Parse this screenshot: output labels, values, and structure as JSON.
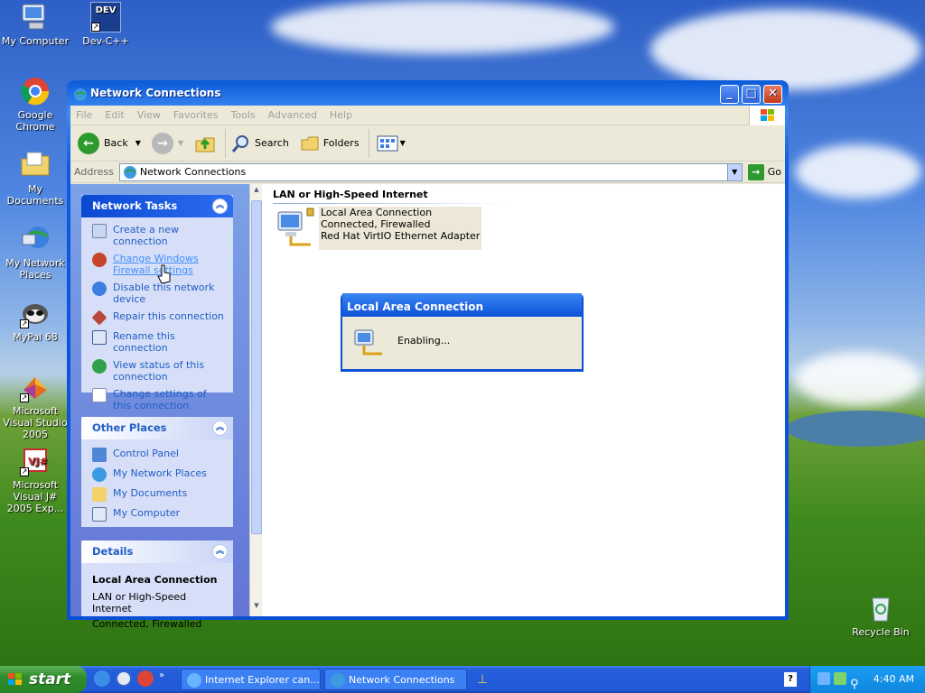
{
  "desktop": {
    "icons": [
      {
        "label": "My Computer"
      },
      {
        "label": "Dev-C++"
      },
      {
        "label": "Google Chrome"
      },
      {
        "label": "My Documents"
      },
      {
        "label": "My Network Places"
      },
      {
        "label": "MyPal 68"
      },
      {
        "label": "Microsoft Visual Studio 2005"
      },
      {
        "label": "Microsoft Visual J# 2005 Exp..."
      },
      {
        "label": "Recycle Bin"
      }
    ],
    "devcpp_badge": "DEV"
  },
  "window": {
    "title": "Network Connections",
    "minimize": "_",
    "maximize": "□",
    "close": "✕",
    "menu": [
      "File",
      "Edit",
      "View",
      "Favorites",
      "Tools",
      "Advanced",
      "Help"
    ],
    "toolbar": {
      "back": "Back",
      "search": "Search",
      "folders": "Folders"
    },
    "address": {
      "label": "Address",
      "value": "Network Connections",
      "go": "Go"
    }
  },
  "left_panel": {
    "network_tasks": {
      "title": "Network Tasks",
      "items": [
        {
          "label": "Create a new connection",
          "icon": "new-connection-icon"
        },
        {
          "label": "Change Windows Firewall settings",
          "icon": "firewall-icon"
        },
        {
          "label": "Disable this network device",
          "icon": "disable-network-icon"
        },
        {
          "label": "Repair this connection",
          "icon": "repair-icon"
        },
        {
          "label": "Rename this connection",
          "icon": "rename-icon"
        },
        {
          "label": "View status of this connection",
          "icon": "status-icon"
        },
        {
          "label": "Change settings of this connection",
          "icon": "settings-icon"
        }
      ]
    },
    "other_places": {
      "title": "Other Places",
      "items": [
        {
          "label": "Control Panel"
        },
        {
          "label": "My Network Places"
        },
        {
          "label": "My Documents"
        },
        {
          "label": "My Computer"
        }
      ]
    },
    "details": {
      "title": "Details",
      "name": "Local Area Connection",
      "type": "LAN or High-Speed Internet",
      "status": "Connected, Firewalled"
    }
  },
  "main": {
    "group_header": "LAN or High-Speed Internet",
    "connection": {
      "name": "Local Area Connection",
      "status": "Connected, Firewalled",
      "adapter": "Red Hat VirtIO Ethernet Adapter"
    }
  },
  "dialog": {
    "title": "Local Area Connection",
    "message": "Enabling..."
  },
  "taskbar": {
    "start": "start",
    "tasks": [
      {
        "label": "Internet Explorer can..."
      },
      {
        "label": "Network Connections"
      }
    ],
    "clock": "4:40 AM"
  }
}
